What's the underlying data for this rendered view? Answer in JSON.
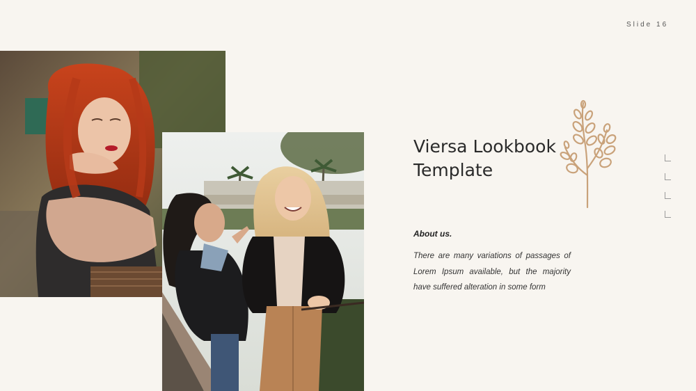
{
  "slide": {
    "number_label": "Slide 16"
  },
  "title": {
    "line1": "Viersa Lookbook",
    "line2": "Template"
  },
  "about": {
    "heading": "About us.",
    "body": "There are many variations of passages of Lorem Ipsum available, but the majority have suffered alteration in some form"
  },
  "images": [
    {
      "name": "photo-red-haired-woman"
    },
    {
      "name": "photo-two-women-laughing"
    }
  ],
  "decor": {
    "branch_icon": "leaf-branch-icon"
  },
  "colors": {
    "background": "#f8f5f0",
    "accent": "#c9a27a",
    "text": "#2a2a2a"
  },
  "nav_markers_count": 4
}
